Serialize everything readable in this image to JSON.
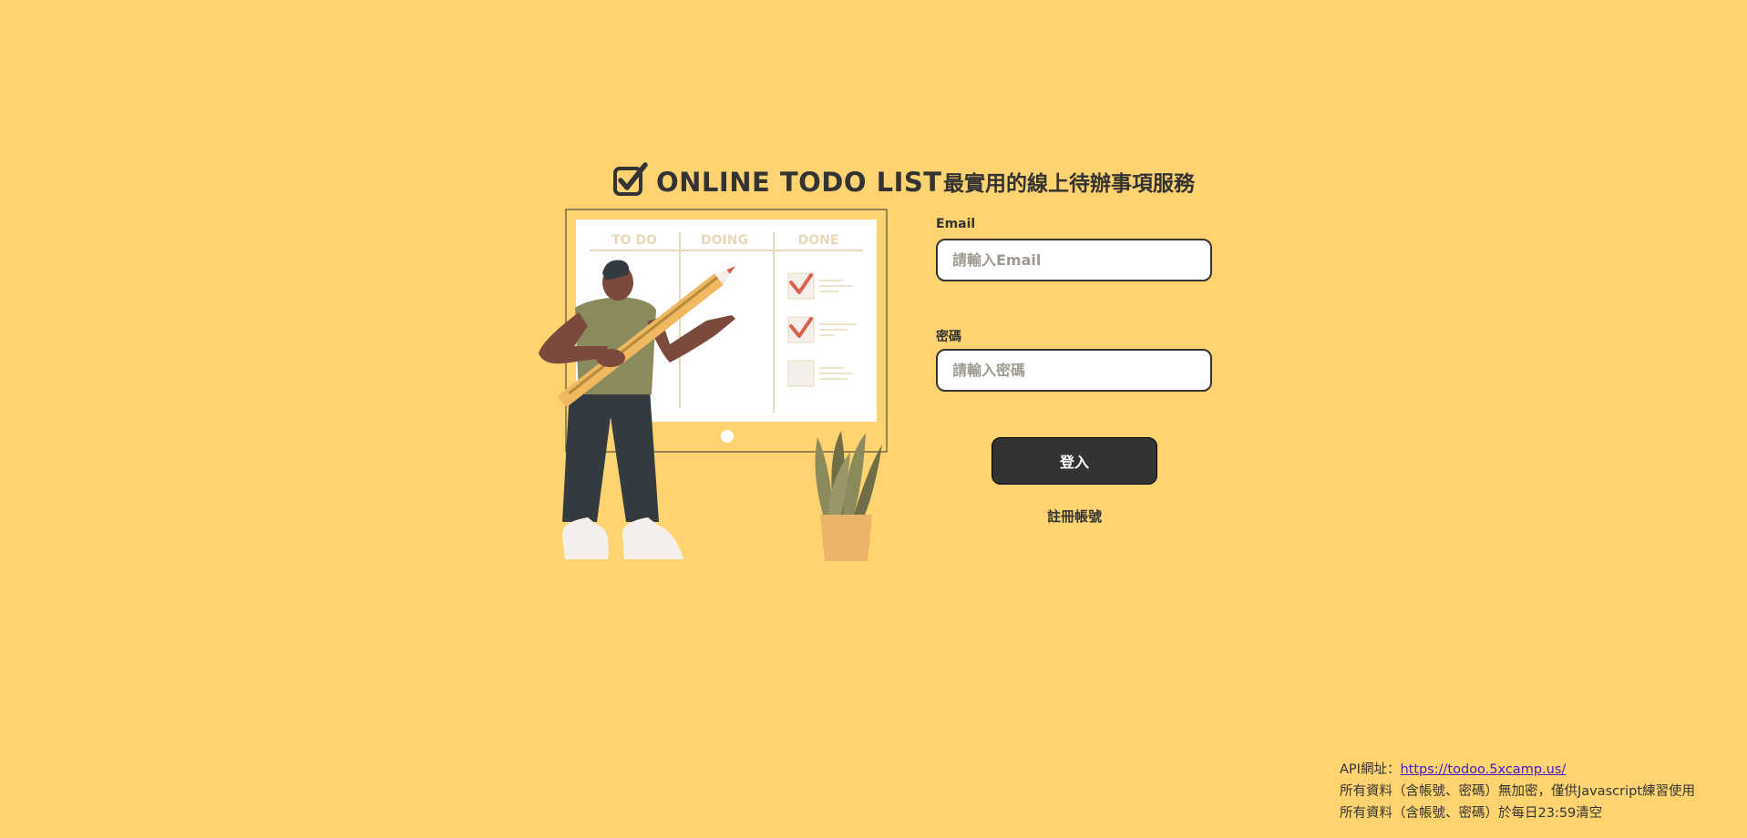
{
  "logo": {
    "text": "ONLINE TODO LIST",
    "icon": "checkbox-check-icon"
  },
  "illustration": {
    "board_columns": [
      "TO DO",
      "DOING",
      "DONE"
    ]
  },
  "form": {
    "slogan": "最實用的線上待辦事項服務",
    "email": {
      "label": "Email",
      "placeholder": "請輸入Email",
      "value": ""
    },
    "password": {
      "label": "密碼",
      "placeholder": "請輸入密碼",
      "value": ""
    },
    "login_label": "登入",
    "register_label": "註冊帳號"
  },
  "footer": {
    "api_prefix": "API網址：",
    "api_url": "https://todoo.5xcamp.us/",
    "note1": "所有資料（含帳號、密碼）無加密，僅供Javascript練習使用",
    "note2": "所有資料（含帳號、密碼）於每日23:59清空"
  },
  "colors": {
    "background": "#FFD370",
    "primary": "#333333",
    "link": "#3E1EBF"
  }
}
